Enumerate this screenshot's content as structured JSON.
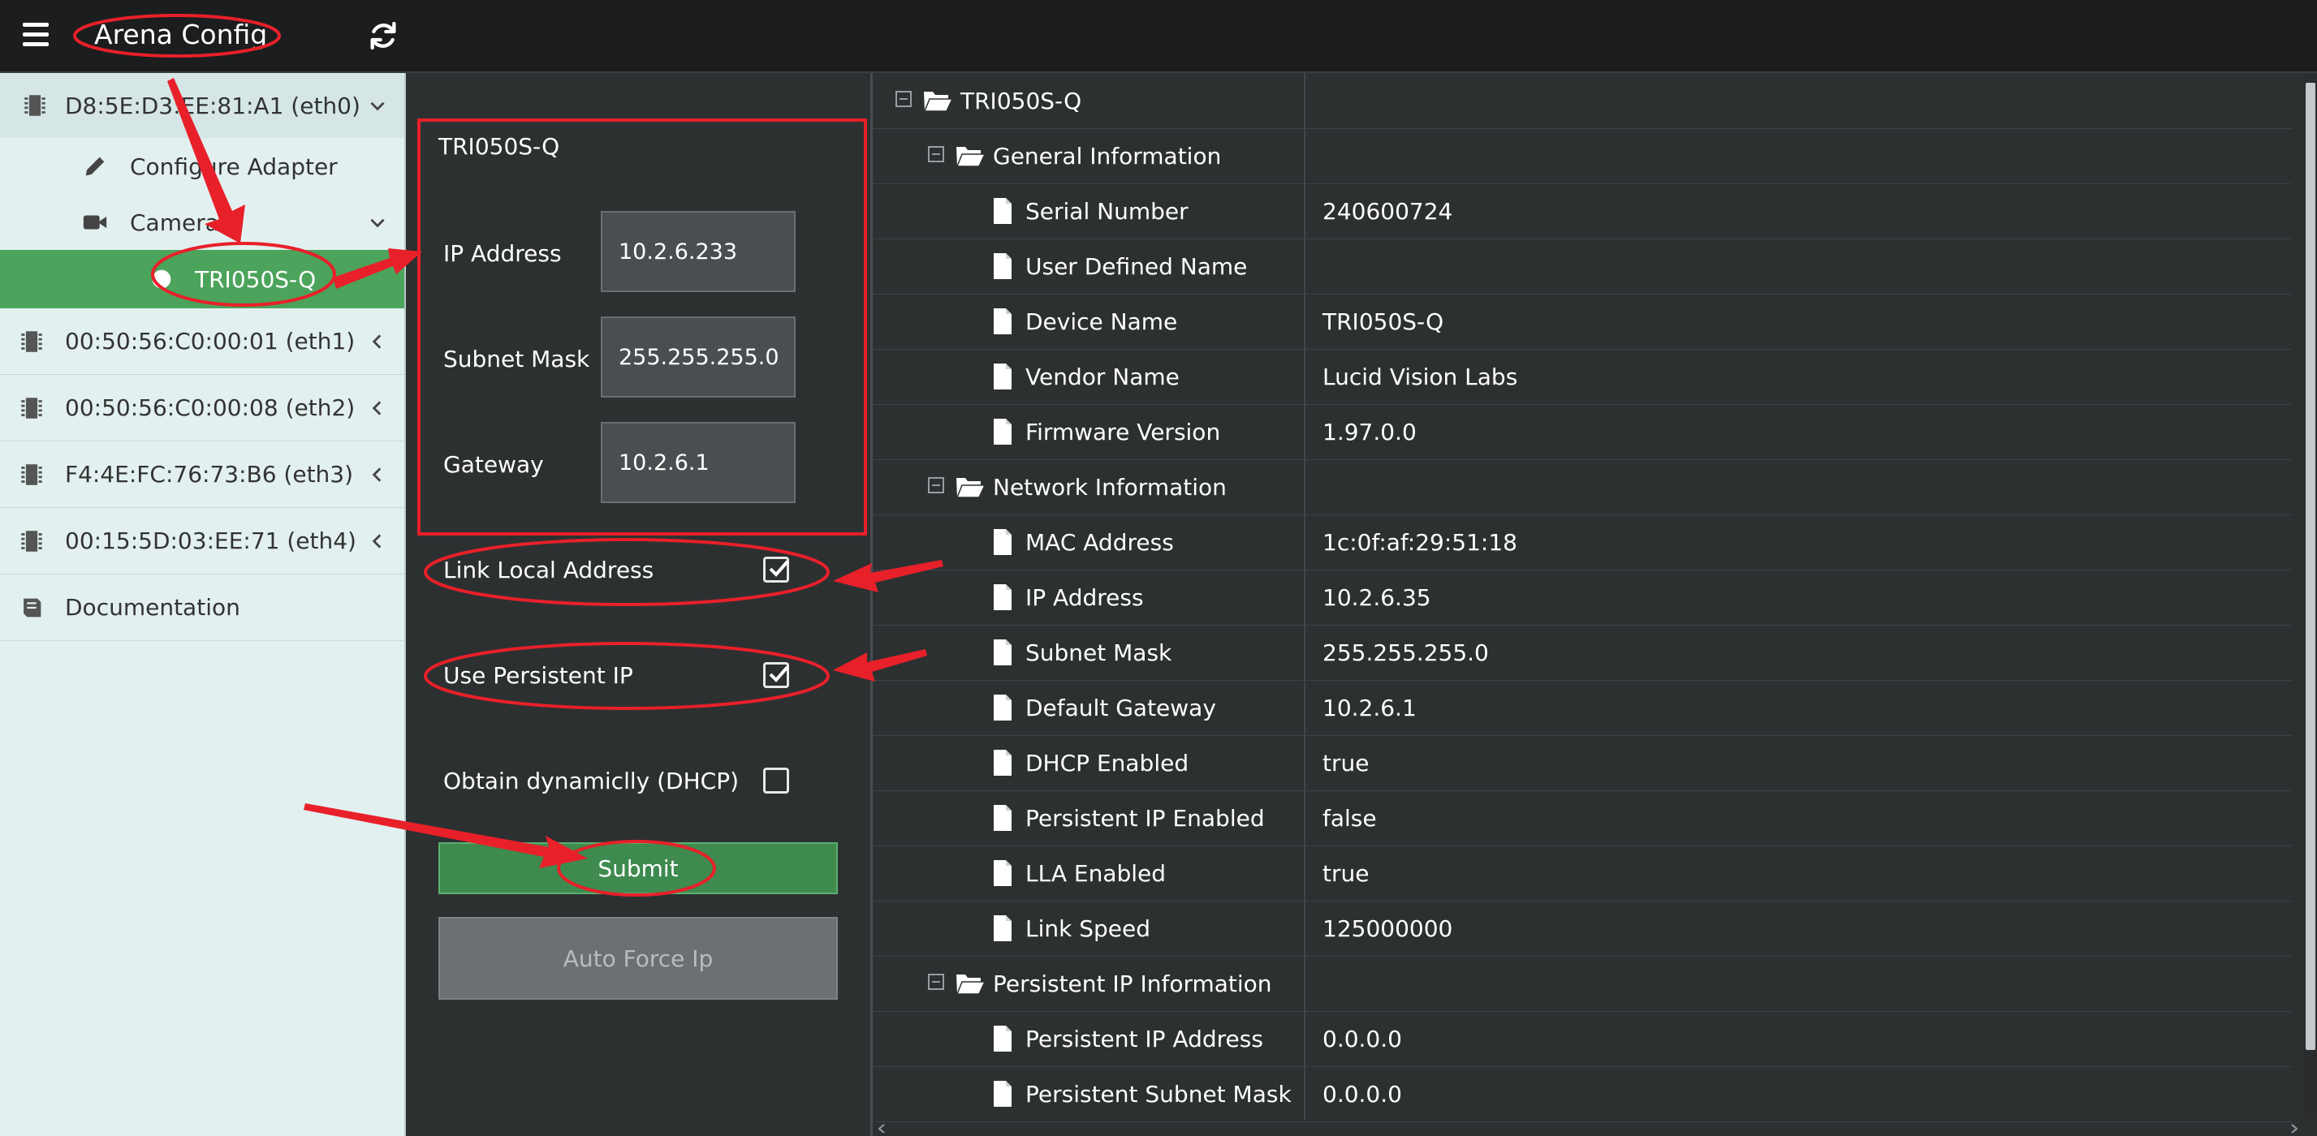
{
  "app": {
    "title": "Arena Config"
  },
  "sidebar": {
    "adapter0": {
      "label": "D8:5E:D3:EE:81:A1 (eth0)"
    },
    "configure": {
      "label": "Configure Adapter"
    },
    "cameras": {
      "label": "Cameras"
    },
    "camera": {
      "label": "TRI050S-Q"
    },
    "adapters": [
      {
        "label": "00:50:56:C0:00:01 (eth1)"
      },
      {
        "label": "00:50:56:C0:00:08 (eth2)"
      },
      {
        "label": "F4:4E:FC:76:73:B6 (eth3)"
      },
      {
        "label": "00:15:5D:03:EE:71 (eth4)"
      }
    ],
    "documentation": {
      "label": "Documentation"
    }
  },
  "form": {
    "device": "TRI050S-Q",
    "ip_label": "IP Address",
    "ip_value": "10.2.6.233",
    "subnet_label": "Subnet Mask",
    "subnet_value": "255.255.255.0",
    "gateway_label": "Gateway",
    "gateway_value": "10.2.6.1",
    "lla_label": "Link Local Address",
    "lla_checked": true,
    "persistent_label": "Use Persistent IP",
    "persistent_checked": true,
    "dhcp_label": "Obtain dynamiclly (DHCP)",
    "dhcp_checked": false,
    "submit_label": "Submit",
    "auto_force_label": "Auto Force Ip"
  },
  "tree": {
    "root": "TRI050S-Q",
    "rows": [
      {
        "kind": "group",
        "name": "General Information"
      },
      {
        "kind": "prop",
        "name": "Serial Number",
        "value": "240600724"
      },
      {
        "kind": "prop",
        "name": "User Defined Name",
        "value": ""
      },
      {
        "kind": "prop",
        "name": "Device Name",
        "value": "TRI050S-Q"
      },
      {
        "kind": "prop",
        "name": "Vendor Name",
        "value": "Lucid Vision Labs"
      },
      {
        "kind": "prop",
        "name": "Firmware Version",
        "value": "1.97.0.0"
      },
      {
        "kind": "group",
        "name": "Network Information"
      },
      {
        "kind": "prop",
        "name": "MAC Address",
        "value": "1c:0f:af:29:51:18"
      },
      {
        "kind": "prop",
        "name": "IP Address",
        "value": "10.2.6.35"
      },
      {
        "kind": "prop",
        "name": "Subnet Mask",
        "value": "255.255.255.0"
      },
      {
        "kind": "prop",
        "name": "Default Gateway",
        "value": "10.2.6.1"
      },
      {
        "kind": "prop",
        "name": "DHCP Enabled",
        "value": "true"
      },
      {
        "kind": "prop",
        "name": "Persistent IP Enabled",
        "value": "false"
      },
      {
        "kind": "prop",
        "name": "LLA Enabled",
        "value": "true"
      },
      {
        "kind": "prop",
        "name": "Link Speed",
        "value": "125000000"
      },
      {
        "kind": "group",
        "name": "Persistent IP Information"
      },
      {
        "kind": "prop",
        "name": "Persistent IP Address",
        "value": "0.0.0.0"
      },
      {
        "kind": "prop",
        "name": "Persistent Subnet Mask",
        "value": "0.0.0.0"
      }
    ]
  },
  "colors": {
    "selected": "#4ca35b",
    "submit": "#3e8a4f",
    "annotation": "#e8202a",
    "sidebar_bg": "#e3f0f0",
    "panel_bg": "#2d3031"
  },
  "icons": {
    "menu": "hamburger-icon",
    "refresh": "refresh-icon",
    "adapter": "chip-icon",
    "configure": "pencil-icon",
    "cameras": "video-camera-icon",
    "camera": "circle-icon",
    "documentation": "book-icon",
    "folder": "folder-open-icon",
    "file": "file-icon",
    "collapse": "minus-square-icon",
    "chevron_down": "chevron-down-icon",
    "chevron_left": "chevron-left-icon"
  }
}
